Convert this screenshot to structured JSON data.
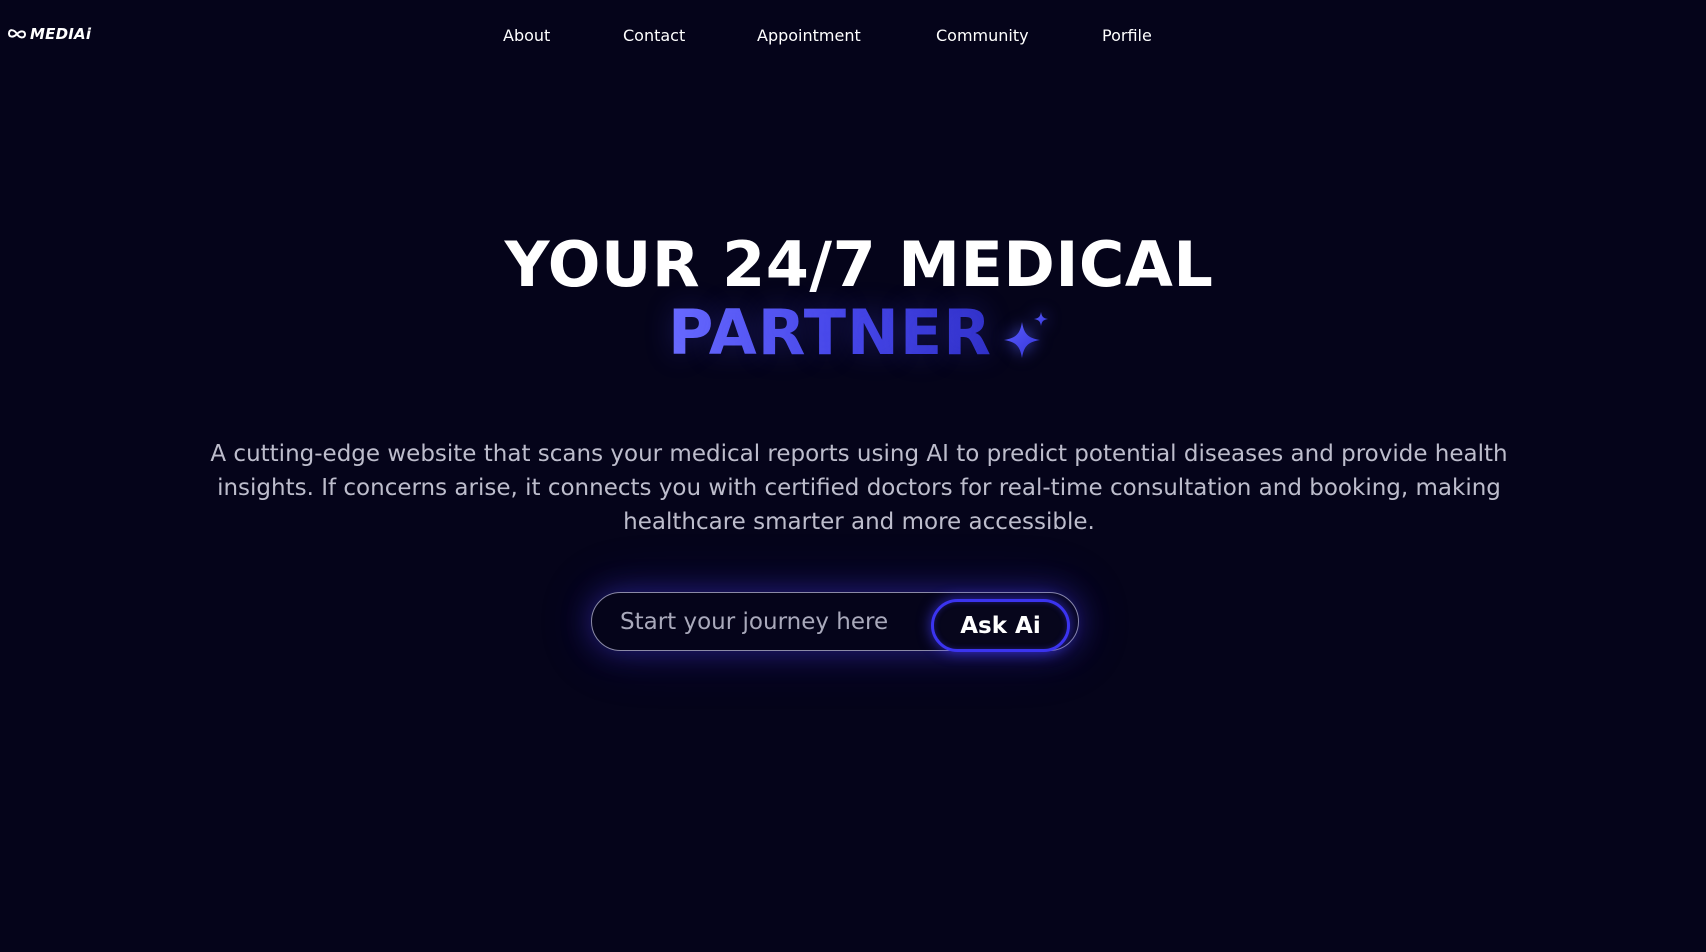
{
  "brand": {
    "name": "MEDIAi",
    "logo_icon": "infinity-heart-icon"
  },
  "nav": {
    "items": [
      {
        "label": "About"
      },
      {
        "label": "Contact"
      },
      {
        "label": "Appointment"
      },
      {
        "label": "Community"
      },
      {
        "label": "Porfile"
      }
    ]
  },
  "hero": {
    "title_line1": "YOUR 24/7 MEDICAL",
    "title_accent": "PARTNER",
    "accent_icon": "sparkle-icon",
    "description": "A cutting-edge website that scans your medical reports using AI to predict potential diseases and provide health insights. If concerns arise, it connects you with certified doctors for real-time consultation and booking, making healthcare smarter and more accessible."
  },
  "ask": {
    "placeholder": "Start your journey here",
    "value": "",
    "button_label": "Ask Ai"
  },
  "colors": {
    "background": "#05041a",
    "accent": "#4b4bf0",
    "text": "#ffffff",
    "muted_text": "#bdbdcc"
  }
}
